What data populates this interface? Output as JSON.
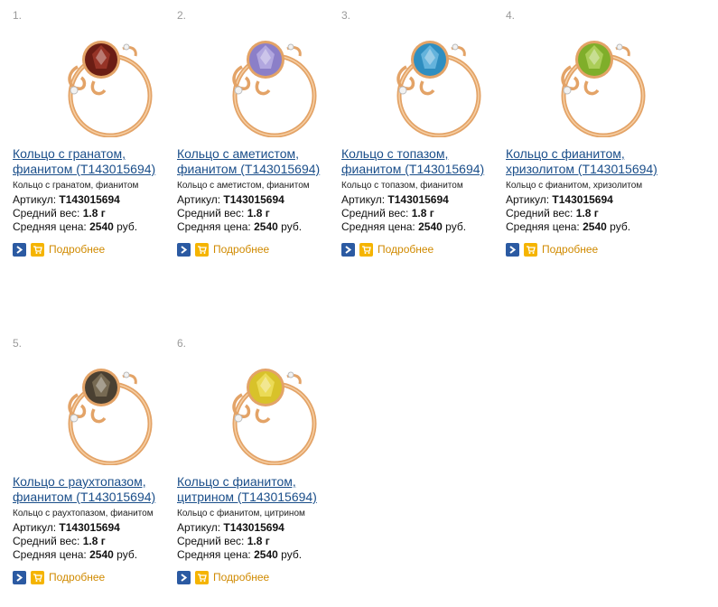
{
  "products": [
    {
      "num": "1.",
      "title_line1": "Кольцо с гранатом,",
      "title_line2": "фианитом (Т143015694)",
      "desc": "Кольцо с гранатом, фианитом",
      "article_label": "Артикул:",
      "article": "Т143015694",
      "weight_label": "Средний вес:",
      "weight": "1.8 г",
      "price_label": "Средняя цена:",
      "price": "2540",
      "currency": "руб.",
      "more": "Подробнее",
      "stone_color": "#6b1d14",
      "stone_light": "#b94634"
    },
    {
      "num": "2.",
      "title_line1": "Кольцо с аметистом,",
      "title_line2": "фианитом (Т143015694)",
      "desc": "Кольцо с аметистом, фианитом",
      "article_label": "Артикул:",
      "article": "Т143015694",
      "weight_label": "Средний вес:",
      "weight": "1.8 г",
      "price_label": "Средняя цена:",
      "price": "2540",
      "currency": "руб.",
      "more": "Подробнее",
      "stone_color": "#8b7fc8",
      "stone_light": "#d2c9f2"
    },
    {
      "num": "3.",
      "title_line1": "Кольцо с топазом,",
      "title_line2": "фианитом (Т143015694)",
      "desc": "Кольцо с топазом, фианитом",
      "article_label": "Артикул:",
      "article": "Т143015694",
      "weight_label": "Средний вес:",
      "weight": "1.8 г",
      "price_label": "Средняя цена:",
      "price": "2540",
      "currency": "руб.",
      "more": "Подробнее",
      "stone_color": "#2f8ec0",
      "stone_light": "#8fd2f2"
    },
    {
      "num": "4.",
      "title_line1": "Кольцо с фианитом,",
      "title_line2": "хризолитом (Т143015694)",
      "desc": "Кольцо с фианитом, хризолитом",
      "article_label": "Артикул:",
      "article": "Т143015694",
      "weight_label": "Средний вес:",
      "weight": "1.8 г",
      "price_label": "Средняя цена:",
      "price": "2540",
      "currency": "руб.",
      "more": "Подробнее",
      "stone_color": "#7fae2a",
      "stone_light": "#cfe77e"
    },
    {
      "num": "5.",
      "title_line1": "Кольцо с раухтопазом,",
      "title_line2": "фианитом (Т143015694)",
      "desc": "Кольцо с раухтопазом, фианитом",
      "article_label": "Артикул:",
      "article": "Т143015694",
      "weight_label": "Средний вес:",
      "weight": "1.8 г",
      "price_label": "Средняя цена:",
      "price": "2540",
      "currency": "руб.",
      "more": "Подробнее",
      "stone_color": "#4a4032",
      "stone_light": "#9c8c70"
    },
    {
      "num": "6.",
      "title_line1": "Кольцо с фианитом,",
      "title_line2": "цитрином (Т143015694)",
      "desc": "Кольцо с фианитом, цитрином",
      "article_label": "Артикул:",
      "article": "Т143015694",
      "weight_label": "Средний вес:",
      "weight": "1.8 г",
      "price_label": "Средняя цена:",
      "price": "2540",
      "currency": "руб.",
      "more": "Подробнее",
      "stone_color": "#d8c22a",
      "stone_light": "#fbf07a"
    }
  ],
  "colors": {
    "link": "#1a4e8a",
    "more": "#d08a00",
    "go_button": "#2b5aa2",
    "cart_button": "#f5b400",
    "gold": "#e3a367"
  },
  "icons": {
    "go": "chevron-right-icon",
    "cart": "cart-icon"
  }
}
